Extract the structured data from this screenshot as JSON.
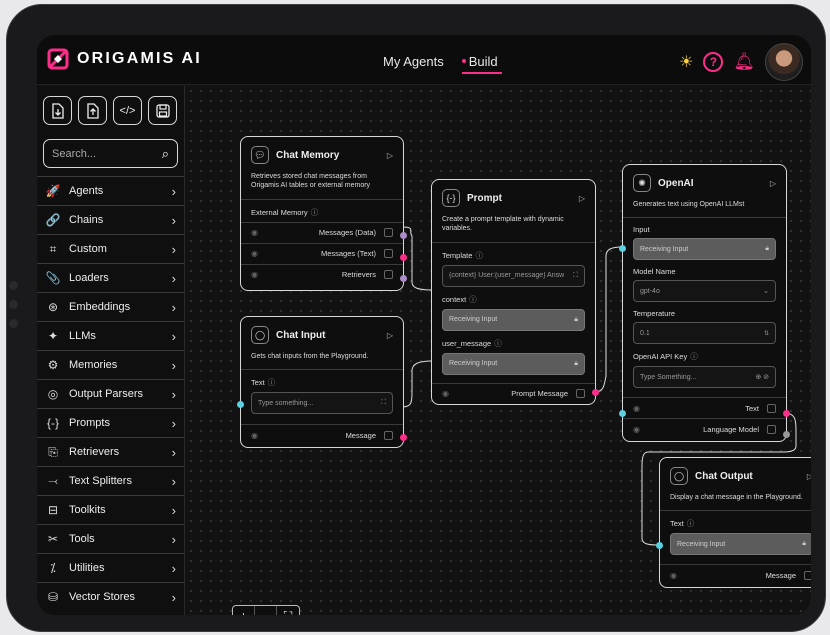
{
  "app": {
    "name": "ORIGAMIS AI"
  },
  "nav": {
    "items": [
      "My Agents",
      "Build"
    ],
    "active": "Build"
  },
  "colors": {
    "accent": "#ff2d8a",
    "cyan": "#5ccfe0",
    "sun": "#ffd23c"
  },
  "toolbar": {
    "icons": [
      "import-icon",
      "export-icon",
      "code-icon",
      "save-icon"
    ],
    "labels": [
      "⇩",
      "⇧",
      "</>",
      "🖫"
    ]
  },
  "search": {
    "placeholder": "Search..."
  },
  "sidebar": {
    "items": [
      {
        "label": "Agents",
        "icon": "🚀"
      },
      {
        "label": "Chains",
        "icon": "🔗"
      },
      {
        "label": "Custom",
        "icon": "⌗"
      },
      {
        "label": "Loaders",
        "icon": "📎"
      },
      {
        "label": "Embeddings",
        "icon": "⊛"
      },
      {
        "label": "LLMs",
        "icon": "✦"
      },
      {
        "label": "Memories",
        "icon": "⚙"
      },
      {
        "label": "Output Parsers",
        "icon": "◎"
      },
      {
        "label": "Prompts",
        "icon": "{-}"
      },
      {
        "label": "Retrievers",
        "icon": "⎘"
      },
      {
        "label": "Text Splitters",
        "icon": "⤙"
      },
      {
        "label": "Toolkits",
        "icon": "⊟"
      },
      {
        "label": "Tools",
        "icon": "✂"
      },
      {
        "label": "Utilities",
        "icon": "⁒"
      },
      {
        "label": "Vector Stores",
        "icon": "⛁"
      }
    ]
  },
  "nodes": {
    "chat_memory": {
      "title": "Chat Memory",
      "desc": "Retrieves stored chat messages from Origamis AI tables or external memory",
      "field_label": "External Memory",
      "outputs": [
        "Messages (Data)",
        "Messages (Text)",
        "Retrievers"
      ]
    },
    "chat_input": {
      "title": "Chat Input",
      "desc": "Gets chat inputs from the Playground.",
      "field_label": "Text",
      "placeholder": "Type something...",
      "output": "Message"
    },
    "prompt": {
      "title": "Prompt",
      "desc": "Create a prompt template with dynamic variables.",
      "template_label": "Template",
      "template_value": "{context} User:{user_message} Answ",
      "context_label": "context",
      "context_value": "Receiving Input",
      "user_label": "user_message",
      "user_value": "Receiving Input",
      "output": "Prompt Message"
    },
    "openai": {
      "title": "OpenAI",
      "desc": "Generates text using OpenAI LLMst",
      "input_label": "Input",
      "input_value": "Receiving Input",
      "model_label": "Model Name",
      "model_value": "gpt-4o",
      "temp_label": "Temperature",
      "temp_value": "0.1",
      "key_label": "OpenAI API Key",
      "key_placeholder": "Type Something...",
      "outputs": [
        "Text",
        "Language Model"
      ]
    },
    "chat_output": {
      "title": "Chat Output",
      "desc": "Display a chat message in the Playground.",
      "field_label": "Text",
      "field_value": "Receiving Input",
      "output": "Message"
    }
  },
  "zoom": {
    "plus": "+",
    "minus": "-",
    "fit": "⛶"
  }
}
